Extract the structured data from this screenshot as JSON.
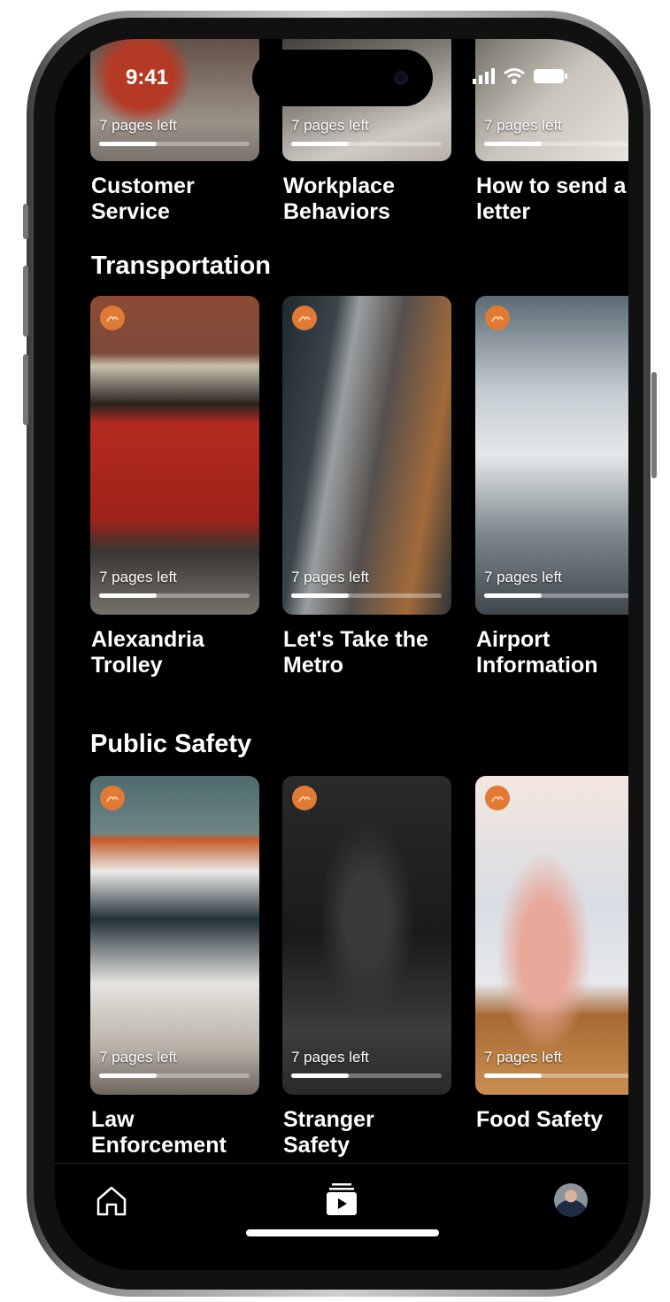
{
  "status_bar": {
    "time": "9:41"
  },
  "top_row": {
    "cards": [
      {
        "title": "Customer\nService",
        "pages_left": "7 pages left",
        "progress": 0.38
      },
      {
        "title": "Workplace\nBehaviors",
        "pages_left": "7 pages left",
        "progress": 0.38
      },
      {
        "title": "How to send a\nletter",
        "pages_left": "7 pages left",
        "progress": 0.38
      }
    ]
  },
  "transportation": {
    "heading": "Transportation",
    "cards": [
      {
        "title": "Alexandria\nTrolley",
        "pages_left": "7 pages left",
        "progress": 0.38
      },
      {
        "title": "Let's Take the\nMetro",
        "pages_left": "7 pages left",
        "progress": 0.38
      },
      {
        "title": "Airport\nInformation",
        "pages_left": "7 pages left",
        "progress": 0.38
      }
    ]
  },
  "public_safety": {
    "heading": "Public Safety",
    "cards": [
      {
        "title": "Law\nEnforcement",
        "pages_left": "7 pages left",
        "progress": 0.38
      },
      {
        "title": "Stranger\nSafety",
        "pages_left": "7 pages left",
        "progress": 0.38
      },
      {
        "title": "Food Safety",
        "pages_left": "7 pages left",
        "progress": 0.38
      }
    ]
  },
  "tabbar": {
    "items": [
      {
        "icon": "home-icon"
      },
      {
        "icon": "library-icon"
      },
      {
        "icon": "profile-avatar"
      }
    ]
  },
  "colors": {
    "badge": "#e07a35",
    "background": "#000000",
    "text": "#ffffff"
  }
}
